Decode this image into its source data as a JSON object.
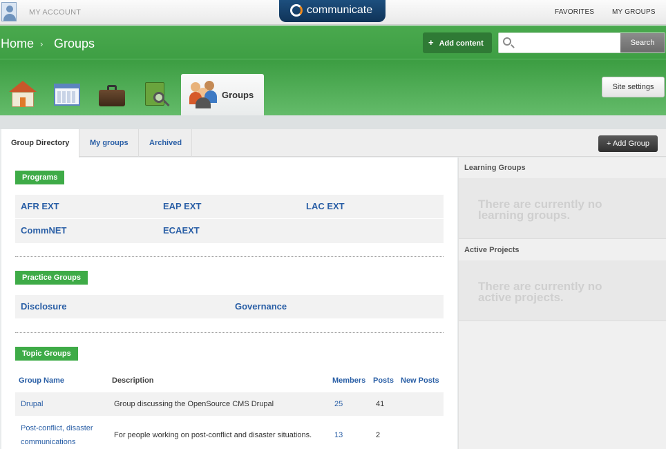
{
  "topbar": {
    "my_account": "MY ACCOUNT",
    "logo_text": "communicate",
    "favorites": "FAVORITES",
    "my_groups": "MY GROUPS"
  },
  "header": {
    "breadcrumb": {
      "home": "Home",
      "separator": "›",
      "current": "Groups"
    },
    "add_content_label": "Add content",
    "add_content_icon": "+",
    "search": {
      "placeholder": "",
      "button_label": "Search"
    },
    "site_settings_label": "Site settings",
    "nav_icons": [
      "home-icon",
      "calendar-icon",
      "briefcase-icon",
      "contacts-icon"
    ],
    "active_section_label": "Groups"
  },
  "tabs": [
    {
      "label": "Group Directory",
      "active": true
    },
    {
      "label": "My groups",
      "active": false
    },
    {
      "label": "Archived",
      "active": false
    }
  ],
  "add_group_label": "+ Add Group",
  "programs": {
    "heading": "Programs",
    "items": [
      "AFR EXT",
      "EAP EXT",
      "LAC EXT",
      "CommNET",
      "ECAEXT"
    ]
  },
  "practice_groups": {
    "heading": "Practice Groups",
    "items": [
      "Disclosure",
      "Governance"
    ]
  },
  "topic_groups": {
    "heading": "Topic Groups",
    "columns": [
      "Group Name",
      "Description",
      "Members",
      "Posts",
      "New Posts"
    ],
    "rows": [
      {
        "name": "Drupal",
        "description": "Group discussing the OpenSource CMS Drupal",
        "members": "25",
        "posts": "41",
        "new_posts": ""
      },
      {
        "name_line1": "Post-conflict, disaster",
        "name_line2": "communications",
        "description": "For people working on post-conflict and disaster situations.",
        "members": "13",
        "posts": "2",
        "new_posts": ""
      }
    ]
  },
  "sidebar": {
    "learning_groups": {
      "heading": "Learning Groups",
      "empty": "There are currently no learning groups."
    },
    "active_projects": {
      "heading": "Active Projects",
      "empty": "There are currently no active projects."
    }
  },
  "colors": {
    "green": "#3eab47",
    "link": "#2a5fa6",
    "logo_bg": "#0f3358"
  }
}
